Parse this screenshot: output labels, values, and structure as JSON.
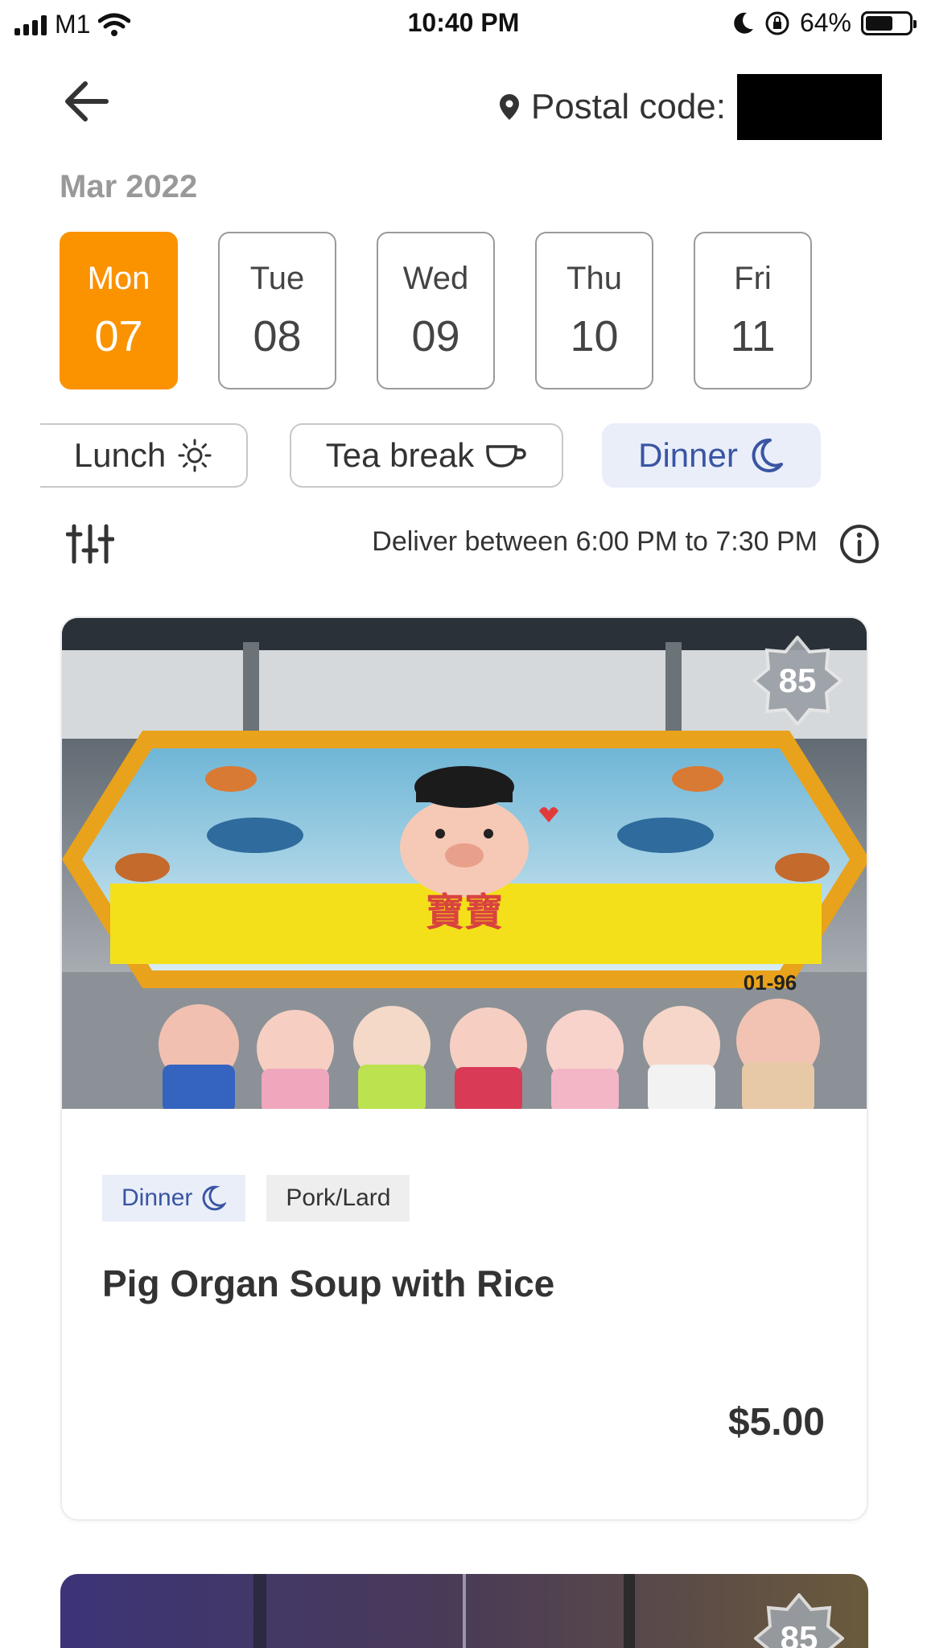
{
  "status_bar": {
    "carrier": "M1",
    "time": "10:40 PM",
    "battery": "64%",
    "battery_level": 0.64
  },
  "header": {
    "postal_label": "Postal code:"
  },
  "month": "Mar 2022",
  "days": [
    {
      "name": "Mon",
      "num": "07",
      "selected": true
    },
    {
      "name": "Tue",
      "num": "08",
      "selected": false
    },
    {
      "name": "Wed",
      "num": "09",
      "selected": false
    },
    {
      "name": "Thu",
      "num": "10",
      "selected": false
    },
    {
      "name": "Fri",
      "num": "11",
      "selected": false
    }
  ],
  "meals": {
    "lunch": "Lunch",
    "tea": "Tea break",
    "dinner": "Dinner",
    "selected": "Dinner"
  },
  "delivery": {
    "text": "Deliver between 6:00 PM to 7:30 PM"
  },
  "cards": [
    {
      "score": "85",
      "tags": [
        "Dinner",
        "Pork/Lard"
      ],
      "name": "Pig Organ Soup with Rice",
      "price": "$5.00",
      "sign_text": "寶寶",
      "stall_no": "01-96"
    },
    {
      "score": "85"
    }
  ],
  "colors": {
    "accent": "#fb9200",
    "dinner_bg": "#e9eef9",
    "dinner_text": "#3a55a3"
  }
}
